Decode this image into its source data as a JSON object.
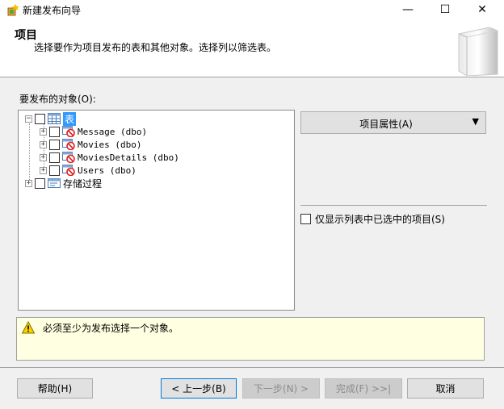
{
  "window": {
    "title": "新建发布向导",
    "controls": {
      "minimize": "—",
      "maximize": "☐",
      "close": "✕"
    }
  },
  "header": {
    "title": "项目",
    "description": "选择要作为项目发布的表和其他对象。选择列以筛选表。"
  },
  "objects_label": "要发布的对象(O):",
  "tree": {
    "tables_node": "表",
    "tables": [
      {
        "label": "Message (dbo)"
      },
      {
        "label": "Movies (dbo)"
      },
      {
        "label": "MoviesDetails (dbo)"
      },
      {
        "label": "Users (dbo)"
      }
    ],
    "procedures_node": "存储过程"
  },
  "properties_button": {
    "label": "项目属性(A)",
    "arrow": "▼"
  },
  "only_selected_checkbox": "仅显示列表中已选中的项目(S)",
  "message": "必须至少为发布选择一个对象。",
  "buttons": {
    "help": "帮助(H)",
    "back": "< 上一步(B)",
    "next": "下一步(N) >",
    "finish": "完成(F) >>|",
    "cancel": "取消"
  }
}
